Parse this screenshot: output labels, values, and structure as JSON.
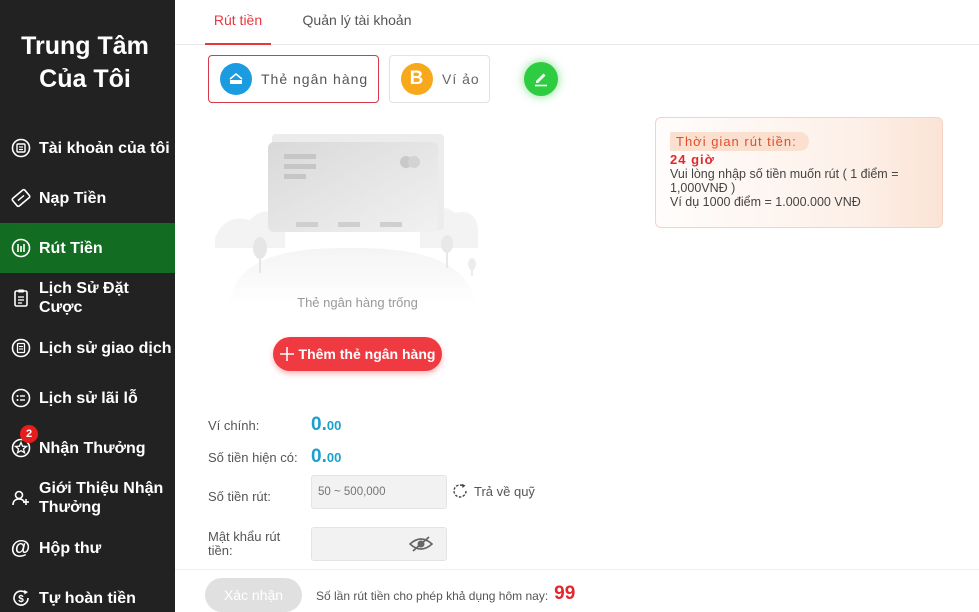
{
  "sidebar": {
    "title_line1": "Trung Tâm",
    "title_line2": "Của Tôi",
    "items": [
      {
        "label": "Tài khoản của tôi",
        "icon": "account-icon"
      },
      {
        "label": "Nạp Tiền",
        "icon": "deposit-icon"
      },
      {
        "label": "Rút Tiền",
        "icon": "withdraw-icon",
        "active": true
      },
      {
        "label": "Lịch Sử Đặt Cược",
        "icon": "bet-history-icon"
      },
      {
        "label": "Lịch sử giao dịch",
        "icon": "transaction-history-icon"
      },
      {
        "label": "Lịch sử lãi lỗ",
        "icon": "profit-loss-icon"
      },
      {
        "label": "Nhận Thưởng",
        "icon": "reward-icon",
        "badge": "2"
      },
      {
        "label": "Giới Thiệu Nhận Thưởng",
        "icon": "referral-icon"
      },
      {
        "label": "Hộp thư",
        "icon": "mail-icon"
      },
      {
        "label": "Tự hoàn tiền",
        "icon": "cashback-icon"
      }
    ]
  },
  "tabs": [
    {
      "label": "Rút tiền",
      "active": true
    },
    {
      "label": "Quản lý tài khoản"
    }
  ],
  "methods": [
    {
      "label": "Thẻ ngân hàng",
      "icon": "bank-card-icon",
      "active": true
    },
    {
      "label": "Ví ảo",
      "icon": "bitcoin-icon"
    }
  ],
  "info": {
    "title": "Thời gian rút tiền:",
    "hours": "24 giờ",
    "line1": "Vui lòng nhập số tiền muốn rút ( 1 điểm = 1,000VNĐ )",
    "line2": "Ví dụ 1000 điểm = 1.000.000 VNĐ"
  },
  "empty": {
    "text": "Thẻ ngân hàng trống",
    "add_button": "Thêm thẻ ngân hàng"
  },
  "form": {
    "main_wallet_label": "Ví chính:",
    "main_wallet_int": "0.",
    "main_wallet_dec": "00",
    "available_label": "Số tiền hiện có:",
    "available_int": "0.",
    "available_dec": "00",
    "amount_label": "Số tiền rút:",
    "amount_placeholder": "50 ~ 500,000",
    "refund_label": "Trả về quỹ",
    "password_label": "Mật khẩu rút tiền:",
    "password_value": ""
  },
  "footer": {
    "confirm_label": "Xác nhận",
    "remaining_label": "Số lần rút tiền cho phép khả dụng hôm nay:",
    "remaining_count": "99"
  },
  "colors": {
    "sidebar_bg": "#222222",
    "active_green": "#126d23",
    "accent_red": "#e8383d",
    "amount_blue": "#1aa0cf"
  }
}
